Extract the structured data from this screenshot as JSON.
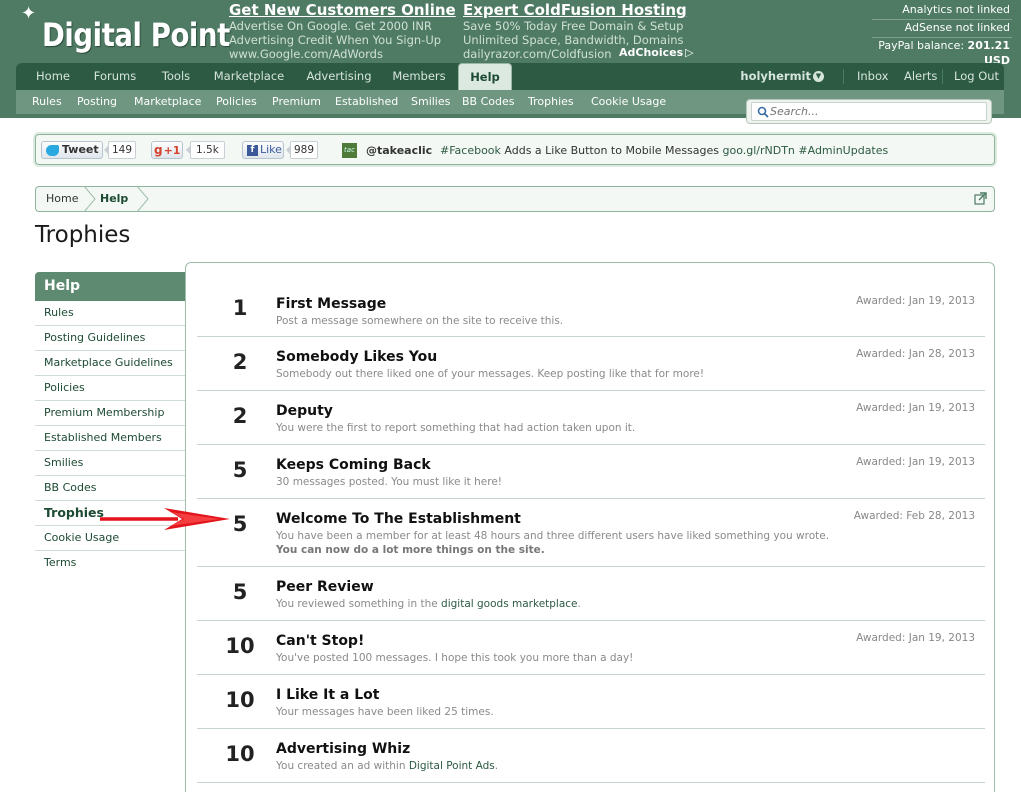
{
  "header": {
    "logo": "Digital Point",
    "ads": [
      {
        "title": "Get New Customers Online",
        "lines": [
          "Advertise On Google. Get 2000 INR",
          "Advertising Credit When You Sign-Up",
          "www.Google.com/AdWords"
        ]
      },
      {
        "title": "Expert ColdFusion Hosting",
        "lines": [
          "Save 50% Today Free Domain & Setup",
          "Unlimited Space, Bandwidth, Domains",
          "dailyrazor.com/Coldfusion"
        ]
      }
    ],
    "adchoices": "AdChoices",
    "account": {
      "analytics": "Analytics not linked",
      "adsense": "AdSense not linked",
      "paypal_label": "PayPal balance:",
      "paypal_value": "201.21 USD"
    }
  },
  "nav": {
    "tabs": [
      "Home",
      "Forums",
      "Tools",
      "Marketplace",
      "Advertising",
      "Members",
      "Help"
    ],
    "active": "Help",
    "username": "holyhermit",
    "right": [
      "Inbox",
      "Alerts",
      "Log Out"
    ]
  },
  "subnav": {
    "items": [
      "Rules",
      "Posting",
      "Marketplace",
      "Policies",
      "Premium",
      "Established",
      "Smilies",
      "BB Codes",
      "Trophies",
      "Cookie Usage"
    ]
  },
  "search": {
    "placeholder": "Search..."
  },
  "social": {
    "tweet_label": "Tweet",
    "tweet_count": "149",
    "gplus_label": "+1",
    "gplus_count": "1.5k",
    "like_label": "Like",
    "like_count": "989",
    "twitter_handle": "@takeaclic",
    "tweet_hashtag": "#Facebook",
    "tweet_body": "Adds a Like Button to Mobile Messages",
    "tweet_link": "goo.gl/rNDTn",
    "tweet_tag2": "#AdminUpdates"
  },
  "breadcrumb": [
    "Home",
    "Help"
  ],
  "page_title": "Trophies",
  "sidebar": {
    "heading": "Help",
    "items": [
      "Rules",
      "Posting Guidelines",
      "Marketplace Guidelines",
      "Policies",
      "Premium Membership",
      "Established Members",
      "Smilies",
      "BB Codes",
      "Trophies",
      "Cookie Usage",
      "Terms"
    ],
    "active": "Trophies"
  },
  "trophies": [
    {
      "points": "1",
      "name": "First Message",
      "desc": "Post a message somewhere on the site to receive this.",
      "awarded": "Awarded: Jan 19, 2013"
    },
    {
      "points": "2",
      "name": "Somebody Likes You",
      "desc": "Somebody out there liked one of your messages. Keep posting like that for more!",
      "awarded": "Awarded: Jan 28, 2013"
    },
    {
      "points": "2",
      "name": "Deputy",
      "desc": "You were the first to report something that had action taken upon it.",
      "awarded": "Awarded: Jan 19, 2013"
    },
    {
      "points": "5",
      "name": "Keeps Coming Back",
      "desc": "30 messages posted. You must like it here!",
      "awarded": "Awarded: Jan 19, 2013"
    },
    {
      "points": "5",
      "name": "Welcome To The Establishment",
      "desc": "You have been a member for at least 48 hours and three different users have liked something you wrote.",
      "desc_bold": "You can now do a lot more things on the site.",
      "awarded": "Awarded: Feb 28, 2013"
    },
    {
      "points": "5",
      "name": "Peer Review",
      "desc_pre": "You reviewed something in the",
      "desc_link": "digital goods marketplace",
      "desc_post": ".",
      "awarded": ""
    },
    {
      "points": "10",
      "name": "Can't Stop!",
      "desc": "You've posted 100 messages. I hope this took you more than a day!",
      "awarded": "Awarded: Jan 19, 2013"
    },
    {
      "points": "10",
      "name": "I Like It a Lot",
      "desc": "Your messages have been liked 25 times.",
      "awarded": ""
    },
    {
      "points": "10",
      "name": "Advertising Whiz",
      "desc_pre": "You created an ad within",
      "desc_link": "Digital Point Ads",
      "desc_post": ".",
      "awarded": ""
    }
  ]
}
